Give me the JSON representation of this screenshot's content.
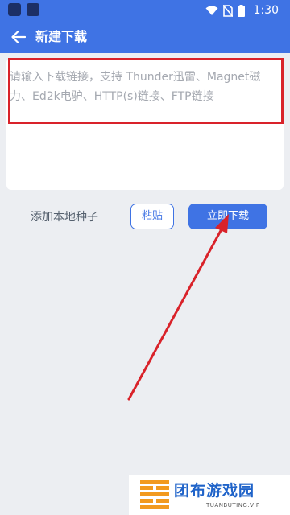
{
  "status_bar": {
    "time": "1:30",
    "icons": [
      "wifi-icon",
      "no-sim-icon",
      "battery-icon"
    ]
  },
  "app_bar": {
    "title": "新建下载",
    "back_icon": "arrow-left-icon"
  },
  "link_input": {
    "value": "",
    "placeholder": "请输入下载链接，支持 Thunder迅雷、Magnet磁力、Ed2k电驴、HTTP(s)链接、FTP链接"
  },
  "actions": {
    "add_local_seed": "添加本地种子",
    "paste": "粘贴",
    "download_now": "立即下载"
  },
  "annotation": {
    "highlight_color": "#d9222a",
    "arrow_color": "#d9222a"
  },
  "watermark": {
    "brand": "团布游戏园",
    "url": "TUANBUTING.VIP"
  },
  "colors": {
    "accent": "#3f73e4",
    "background": "#eceef2"
  }
}
